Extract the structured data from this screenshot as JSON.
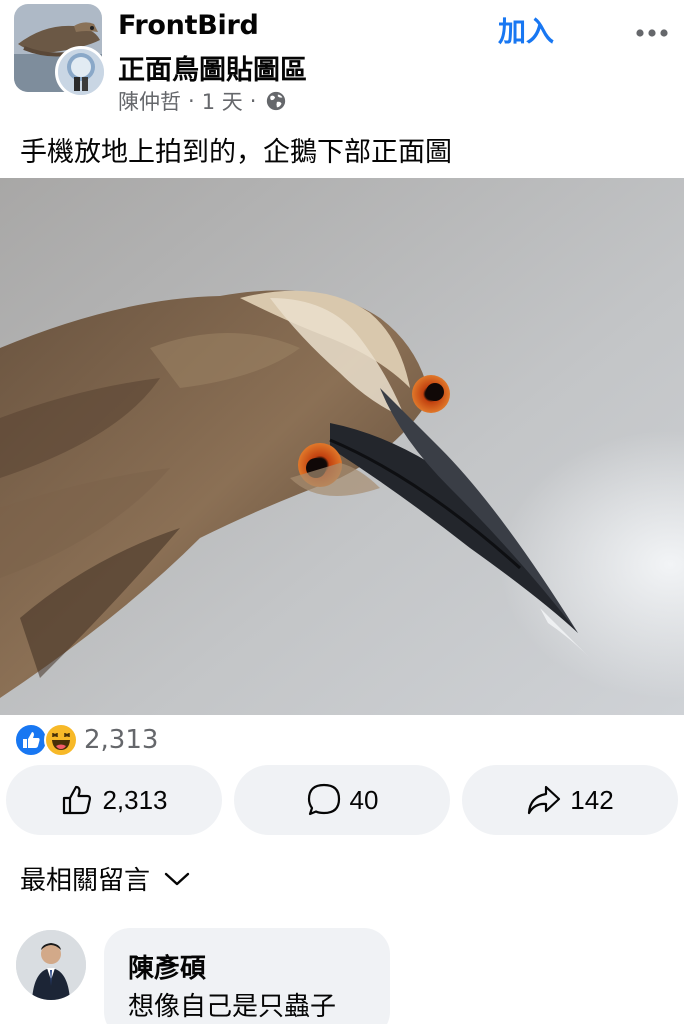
{
  "post": {
    "group_name": "FrontBird",
    "group_subtitle": "正面鳥圖貼圖區",
    "author": "陳仲哲",
    "time": "1 天",
    "separator": "·",
    "join_label": "加入",
    "caption": "手機放地上拍到的，企鵝下部正面圖"
  },
  "icons": {
    "more": "more-horizontal-icon",
    "privacy": "globe-icon",
    "like": "thumbs-up-icon",
    "comment": "comment-bubble-icon",
    "share": "share-arrow-icon",
    "chevron": "chevron-down-icon"
  },
  "reactions": {
    "types": [
      "like",
      "haha"
    ],
    "count": "2,313"
  },
  "actions": {
    "like_count": "2,313",
    "comment_count": "40",
    "share_count": "142"
  },
  "comments_section": {
    "sort_label": "最相關留言"
  },
  "comment": {
    "author": "陳彥碩",
    "text": "想像自己是只蟲子"
  },
  "colors": {
    "accent": "#1877f2",
    "muted": "#65676b",
    "pill_bg": "#f0f2f5",
    "haha": "#f7b928"
  }
}
